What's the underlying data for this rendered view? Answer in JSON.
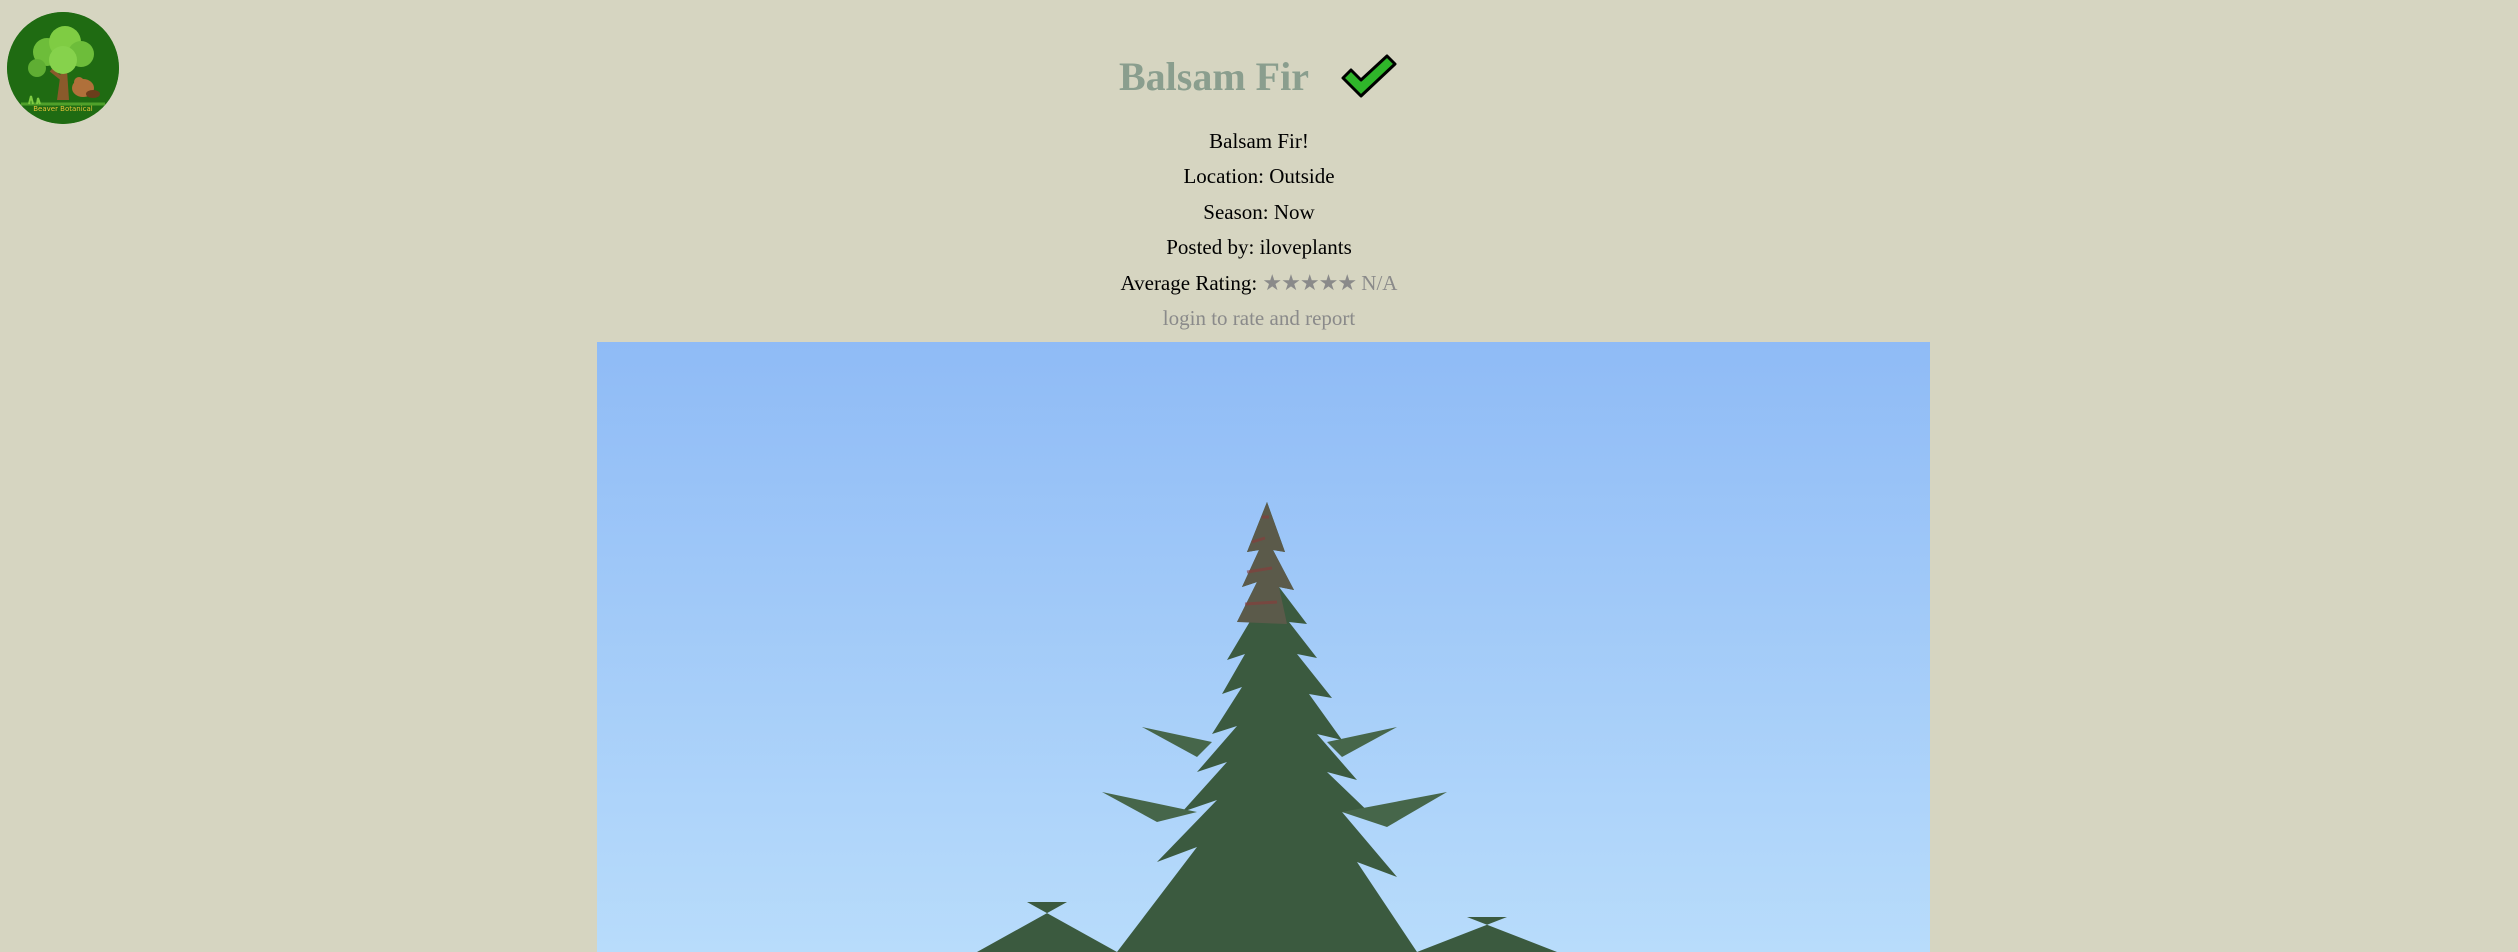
{
  "logo": {
    "text": "Beaver Botanical",
    "icon": "tree-beaver-logo"
  },
  "post": {
    "title": "Balsam Fir",
    "verified_icon": "checkmark-icon",
    "description": "Balsam Fir!",
    "location": "Location: Outside",
    "season": "Season: Now",
    "posted_by": "Posted by: iloveplants",
    "rating_label": "Average Rating:",
    "rating_stars": "★★★★★",
    "rating_value": "N/A",
    "login_link": "login to rate and report"
  },
  "photo": {
    "subject": "balsam-fir-tree"
  },
  "colors": {
    "background": "#d6d5c1",
    "title": "#8a9e8e",
    "check_fill": "#2fb52a",
    "muted_text": "#8a8a8a"
  }
}
